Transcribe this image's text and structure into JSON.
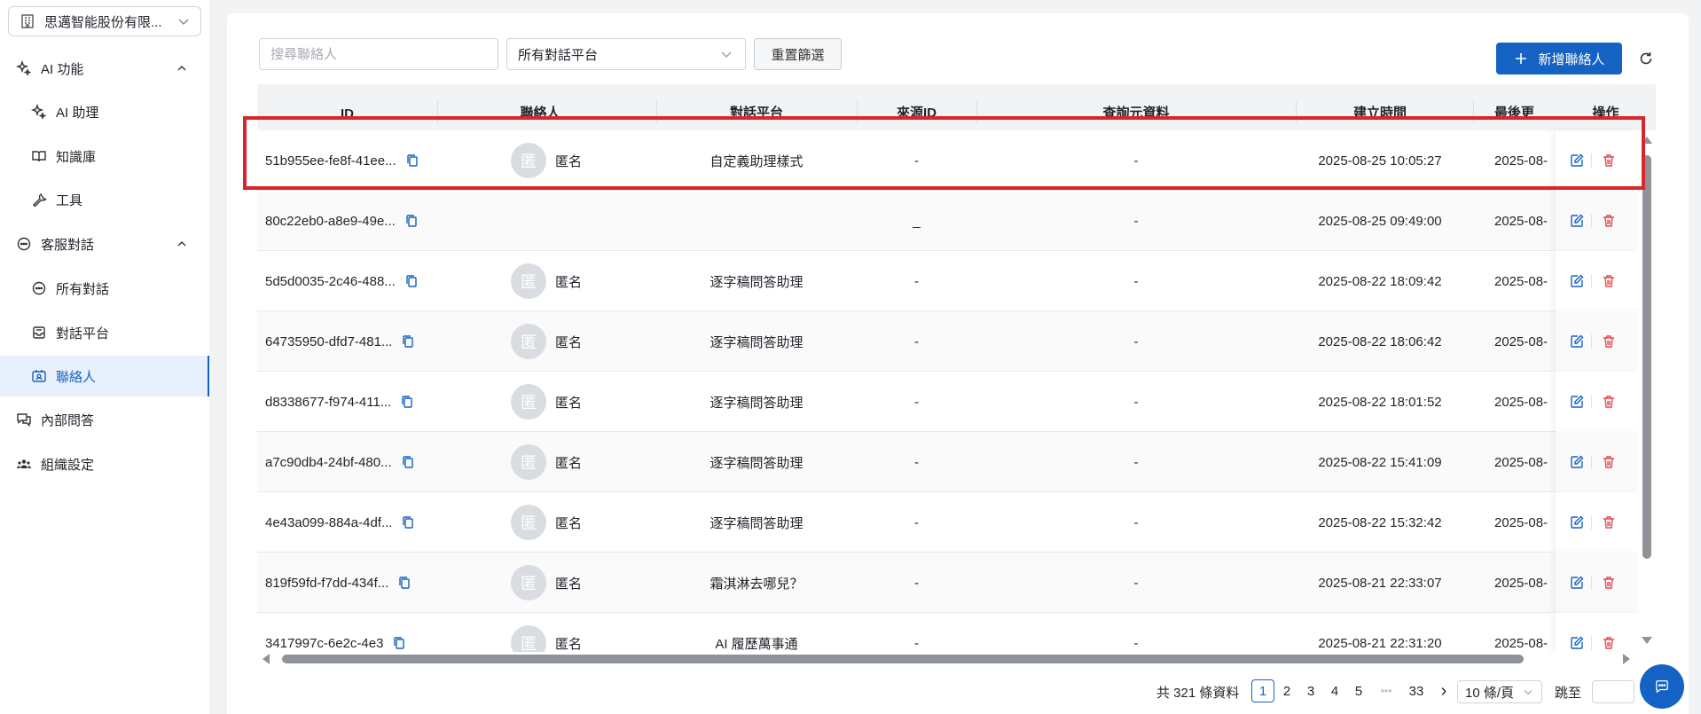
{
  "sidebar": {
    "org_name": "思邁智能股份有限...",
    "menu": {
      "ai": "AI 功能",
      "ai_assistant": "AI 助理",
      "knowledge": "知識庫",
      "tools": "工具",
      "cs": "客服對話",
      "all_conversations": "所有對話",
      "platforms": "對話平台",
      "contacts": "聯絡人",
      "internal_qa": "內部問答",
      "org_settings": "組織設定"
    }
  },
  "filters": {
    "search_placeholder": "搜尋聯絡人",
    "platform_value": "所有對話平台",
    "reset_label": "重置篩選"
  },
  "toolbar": {
    "add_label": "新增聯絡人"
  },
  "table": {
    "headers": {
      "id": "ID",
      "contact": "聯絡人",
      "platform": "對話平台",
      "source_id": "來源ID",
      "metadata": "查詢元資料",
      "created": "建立時間",
      "last": "最後更",
      "actions": "操作"
    },
    "rows": [
      {
        "id": "51b955ee-fe8f-41ee...",
        "avatar": "匿",
        "name": "匿名",
        "platform": "自定義助理樣式",
        "source_id": "-",
        "metadata": "-",
        "created": "2025-08-25 10:05:27",
        "last": "2025-08-"
      },
      {
        "id": "80c22eb0-a8e9-49e...",
        "avatar": "",
        "name": "",
        "platform": "",
        "source_id": "_",
        "metadata": "-",
        "created": "2025-08-25 09:49:00",
        "last": "2025-08-"
      },
      {
        "id": "5d5d0035-2c46-488...",
        "avatar": "匿",
        "name": "匿名",
        "platform": "逐字稿問答助理",
        "source_id": "-",
        "metadata": "-",
        "created": "2025-08-22 18:09:42",
        "last": "2025-08-"
      },
      {
        "id": "64735950-dfd7-481...",
        "avatar": "匿",
        "name": "匿名",
        "platform": "逐字稿問答助理",
        "source_id": "-",
        "metadata": "-",
        "created": "2025-08-22 18:06:42",
        "last": "2025-08-"
      },
      {
        "id": "d8338677-f974-411...",
        "avatar": "匿",
        "name": "匿名",
        "platform": "逐字稿問答助理",
        "source_id": "-",
        "metadata": "-",
        "created": "2025-08-22 18:01:52",
        "last": "2025-08-"
      },
      {
        "id": "a7c90db4-24bf-480...",
        "avatar": "匿",
        "name": "匿名",
        "platform": "逐字稿問答助理",
        "source_id": "-",
        "metadata": "-",
        "created": "2025-08-22 15:41:09",
        "last": "2025-08-"
      },
      {
        "id": "4e43a099-884a-4df...",
        "avatar": "匿",
        "name": "匿名",
        "platform": "逐字稿問答助理",
        "source_id": "-",
        "metadata": "-",
        "created": "2025-08-22 15:32:42",
        "last": "2025-08-"
      },
      {
        "id": "819f59fd-f7dd-434f...",
        "avatar": "匿",
        "name": "匿名",
        "platform": "霜淇淋去哪兒？",
        "source_id": "-",
        "metadata": "-",
        "created": "2025-08-21 22:33:07",
        "last": "2025-08-"
      },
      {
        "id": "3417997c-6e2c-4e3",
        "avatar": "匿",
        "name": "匿名",
        "platform": "AI 履歷萬事通",
        "source_id": "-",
        "metadata": "-",
        "created": "2025-08-21 22:31:20",
        "last": "2025-08-"
      }
    ]
  },
  "pagination": {
    "total": "共 321 條資料",
    "pages": [
      "1",
      "2",
      "3",
      "4",
      "5"
    ],
    "ellipsis": "•••",
    "last_page": "33",
    "next": "›",
    "page_size": "10 條/頁",
    "jump_label": "跳至"
  },
  "colors": {
    "primary": "#1462c4",
    "delete": "#e5484d",
    "highlight": "#d9262c"
  }
}
